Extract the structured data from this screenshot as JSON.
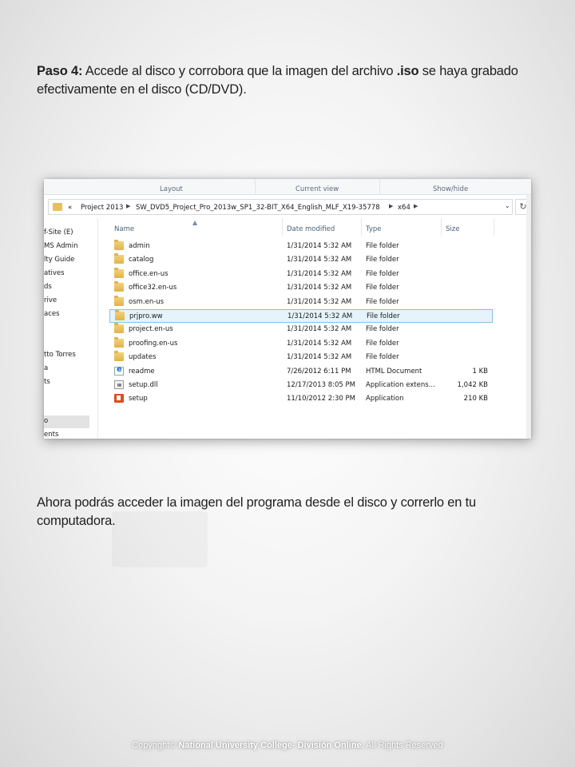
{
  "slide": {
    "step_label": "Paso 4:",
    "step_text_before": " Accede al disco y corrobora que la imagen del archivo ",
    "step_ext": ".iso",
    "step_text_after": " se haya grabado efectivamente en el disco (CD/DVD).",
    "after_text": "Ahora podrás acceder la imagen del programa desde el disco y correrlo en tu computadora.",
    "footer_prefix": "Copyright© ",
    "footer_bold": "National University College- División Online.",
    "footer_suffix": " All Rights Reserved"
  },
  "explorer": {
    "ribbon": {
      "layout": "Layout",
      "current_view": "Current view",
      "show_hide": "Show/hide"
    },
    "address": {
      "prefix": "«",
      "crumbs": [
        "Project 2013",
        "SW_DVD5_Project_Pro_2013w_SP1_32-BIT_X64_English_MLF_X19-35778",
        "x64"
      ]
    },
    "nav_items": [
      "f-Site (E)",
      "MS Admin",
      "lty Guide",
      "atives",
      "ds",
      "rive",
      "aces",
      "",
      "tto Torres",
      "a",
      "ts",
      "o",
      "ents"
    ],
    "columns": {
      "name": "Name",
      "date": "Date modified",
      "type": "Type",
      "size": "Size"
    },
    "files": [
      {
        "name": "admin",
        "date": "1/31/2014 5:32 AM",
        "type": "File folder",
        "size": "",
        "icon": "folder-icon"
      },
      {
        "name": "catalog",
        "date": "1/31/2014 5:32 AM",
        "type": "File folder",
        "size": "",
        "icon": "folder-icon"
      },
      {
        "name": "office.en-us",
        "date": "1/31/2014 5:32 AM",
        "type": "File folder",
        "size": "",
        "icon": "folder-icon"
      },
      {
        "name": "office32.en-us",
        "date": "1/31/2014 5:32 AM",
        "type": "File folder",
        "size": "",
        "icon": "folder-icon"
      },
      {
        "name": "osm.en-us",
        "date": "1/31/2014 5:32 AM",
        "type": "File folder",
        "size": "",
        "icon": "folder-icon"
      },
      {
        "name": "prjpro.ww",
        "date": "1/31/2014 5:32 AM",
        "type": "File folder",
        "size": "",
        "icon": "folder-icon"
      },
      {
        "name": "project.en-us",
        "date": "1/31/2014 5:32 AM",
        "type": "File folder",
        "size": "",
        "icon": "folder-icon"
      },
      {
        "name": "proofing.en-us",
        "date": "1/31/2014 5:32 AM",
        "type": "File folder",
        "size": "",
        "icon": "folder-icon"
      },
      {
        "name": "updates",
        "date": "1/31/2014 5:32 AM",
        "type": "File folder",
        "size": "",
        "icon": "folder-icon"
      },
      {
        "name": "readme",
        "date": "7/26/2012 6:11 PM",
        "type": "HTML Document",
        "size": "1 KB",
        "icon": "html-document-icon"
      },
      {
        "name": "setup.dll",
        "date": "12/17/2013 8:05 PM",
        "type": "Application extens...",
        "size": "1,042 KB",
        "icon": "dll-icon"
      },
      {
        "name": "setup",
        "date": "11/10/2012 2:30 PM",
        "type": "Application",
        "size": "210 KB",
        "icon": "office-setup-icon"
      }
    ],
    "highlighted_row": "prjpro.ww"
  }
}
